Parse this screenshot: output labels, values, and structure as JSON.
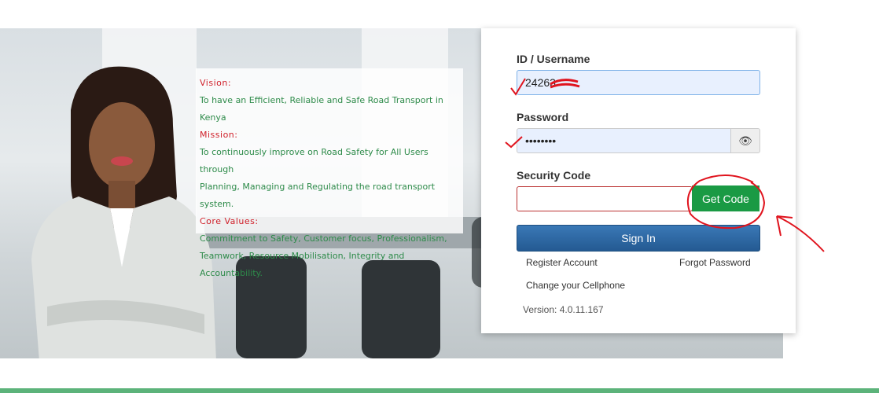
{
  "hero": {
    "vision_heading": "Vision:",
    "vision_text": "To have an Efficient, Reliable and Safe Road Transport in Kenya",
    "mission_heading": "Mission:",
    "mission_text_1": "To continuously improve on Road Safety for All Users through",
    "mission_text_2": "Planning, Managing and Regulating the road transport system.",
    "core_heading": "Core Values:",
    "core_text_1": "Commitment to Safety, Customer focus, Professionalism,",
    "core_text_2": "Teamwork, Resource Mobilisation, Integrity and Accountability."
  },
  "login": {
    "id_label": "ID / Username",
    "id_value": "24263",
    "password_label": "Password",
    "password_value": "••••••••",
    "security_label": "Security Code",
    "security_value": "",
    "get_code_label": "Get Code",
    "sign_in_label": "Sign In",
    "register_link": "Register Account",
    "forgot_link": "Forgot Password",
    "change_phone_link": "Change your Cellphone",
    "version": "Version: 4.0.11.167"
  },
  "icons": {
    "show_password": "eye-icon"
  },
  "colors": {
    "accent_green": "#1a9a44",
    "primary_blue": "#2f6aa8",
    "annotation_red": "#e0141e"
  }
}
